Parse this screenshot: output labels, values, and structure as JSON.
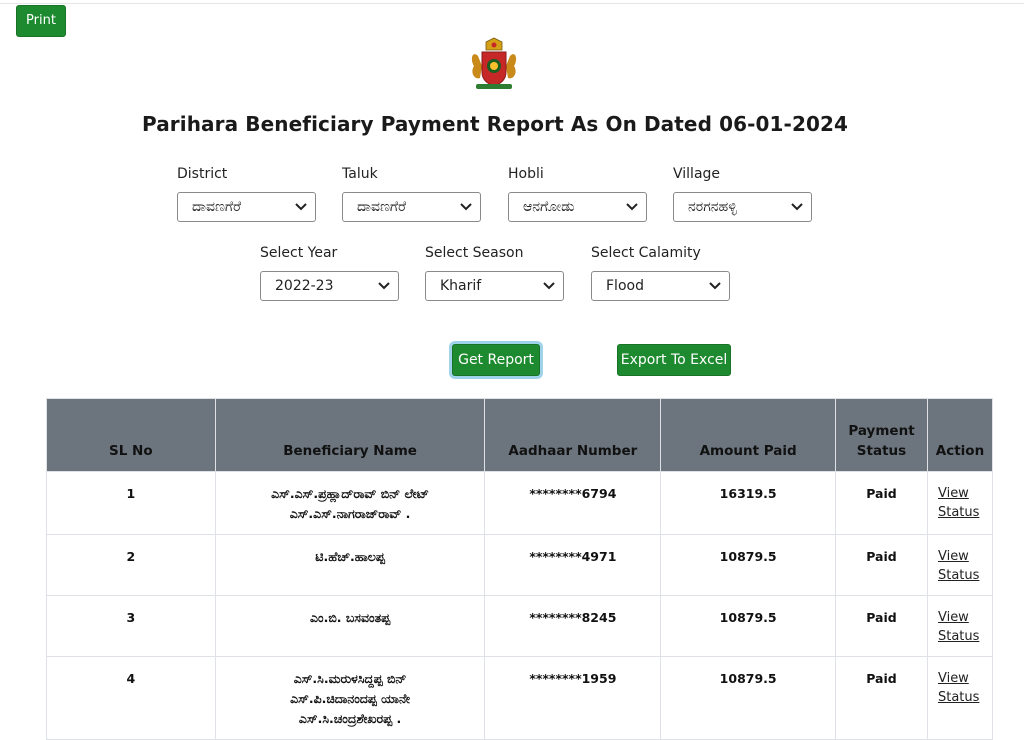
{
  "toolbar": {
    "print_label": "Print"
  },
  "report": {
    "title": "Parihara Beneficiary Payment Report As On Dated 06-01-2024"
  },
  "filters": {
    "district": {
      "label": "District",
      "value": "ದಾವಣಗೆರೆ"
    },
    "taluk": {
      "label": "Taluk",
      "value": "ದಾವಣಗೆರೆ"
    },
    "hobli": {
      "label": "Hobli",
      "value": "ಆನಗೋಡು"
    },
    "village": {
      "label": "Village",
      "value": "ನರಗನಹಳ್ಳಿ"
    },
    "year": {
      "label": "Select Year",
      "value": "2022-23"
    },
    "season": {
      "label": "Select Season",
      "value": "Kharif"
    },
    "calamity": {
      "label": "Select Calamity",
      "value": "Flood"
    }
  },
  "actions": {
    "get_report_label": "Get Report",
    "export_label": "Export To Excel"
  },
  "table": {
    "headers": {
      "sl_no": "SL No",
      "name": "Beneficiary Name",
      "aadhaar": "Aadhaar Number",
      "amount": "Amount Paid",
      "status": "Payment Status",
      "action": "Action"
    },
    "view_label": "View",
    "status_label": "Status",
    "rows": [
      {
        "sl": "1",
        "name": "ಎಸ್.ಎಸ್.ಪ್ರಹ್ಲಾದ್‌ರಾವ್ ಬಿನ್ ಲೇಟ್ ಎಸ್.ಎಸ್.ನಾಗರಾಜ್‌ರಾವ್ .",
        "aadhaar": "********6794",
        "amount": "16319.5",
        "status": "Paid"
      },
      {
        "sl": "2",
        "name": "ಟಿ.ಹೆಚ್.ಹಾಲಪ್ಪ",
        "aadhaar": "********4971",
        "amount": "10879.5",
        "status": "Paid"
      },
      {
        "sl": "3",
        "name": "ಎಂ.ಬಿ. ಬಸವಂತಪ್ಪ",
        "aadhaar": "********8245",
        "amount": "10879.5",
        "status": "Paid"
      },
      {
        "sl": "4",
        "name": "ಎಸ್.ಸಿ.ಮರುಳಸಿದ್ದಪ್ಪ ಬಿನ್ ಎಸ್.ಪಿ.ಚಿದಾನಂದಪ್ಪ ಯಾನೇ ಎಸ್.ಸಿ.ಚಂದ್ರಶೇಖರಪ್ಪ .",
        "aadhaar": "********1959",
        "amount": "10879.5",
        "status": "Paid"
      }
    ]
  },
  "colors": {
    "button_green": "#1e8a2f",
    "header_gray": "#6c757d",
    "focus_ring": "#9fd3ea"
  },
  "icons": {
    "emblem": "karnataka-emblem-icon",
    "select_chevron": "chevron-down-icon"
  }
}
